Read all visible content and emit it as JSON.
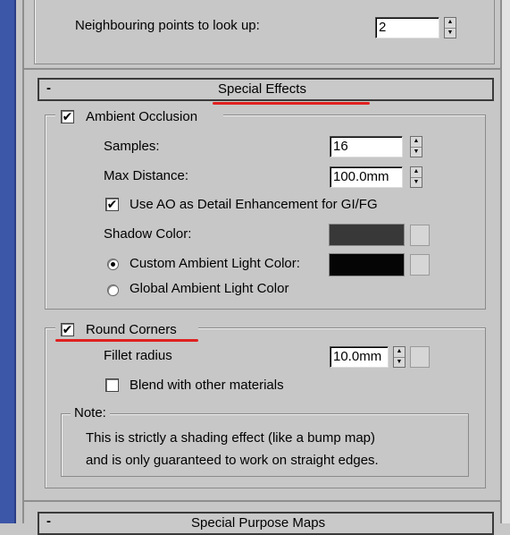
{
  "neighbouring": {
    "label": "Neighbouring points to look up:",
    "value": "2"
  },
  "special_effects": {
    "collapse_symbol": "-",
    "title": "Special Effects"
  },
  "ambient_occlusion": {
    "label": "Ambient Occlusion",
    "checked": true,
    "samples_label": "Samples:",
    "samples_value": "16",
    "max_distance_label": "Max Distance:",
    "max_distance_value": "100.0mm",
    "use_ao_label": "Use AO as Detail Enhancement for GI/FG",
    "use_ao_checked": true,
    "shadow_color_label": "Shadow Color:",
    "shadow_color": "#383838",
    "custom_ambient_label": "Custom Ambient Light Color:",
    "custom_ambient_color": "#050505",
    "global_ambient_label": "Global Ambient Light Color"
  },
  "round_corners": {
    "label": "Round Corners",
    "checked": true,
    "fillet_label": "Fillet radius",
    "fillet_value": "10.0mm",
    "blend_label": "Blend with other materials",
    "blend_checked": false
  },
  "note": {
    "label": "Note:",
    "line1": "This is strictly a shading effect (like a bump map)",
    "line2": "and is only guaranteed to work on straight edges."
  },
  "next_rollout": {
    "collapse_symbol": "-",
    "title": "Special Purpose Maps"
  },
  "colors": {
    "highlight_underline": "#e02020",
    "panel_bg": "#c7c7c7"
  },
  "glyphs": {
    "check": "✔",
    "spin_up": "▲",
    "spin_down": "▼"
  }
}
